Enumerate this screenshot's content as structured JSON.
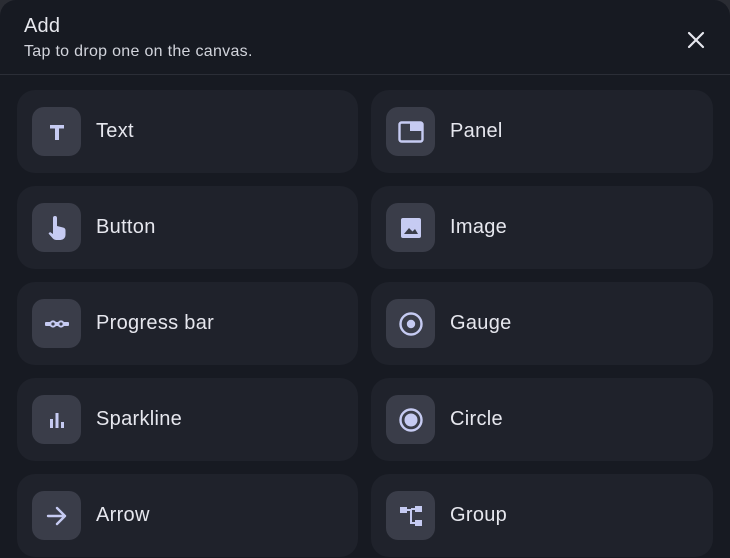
{
  "header": {
    "title": "Add",
    "subtitle": "Tap to drop one on the canvas."
  },
  "close_icon": "close-icon",
  "items": [
    {
      "label": "Text",
      "icon": "text-icon"
    },
    {
      "label": "Panel",
      "icon": "panel-icon"
    },
    {
      "label": "Button",
      "icon": "touch-icon"
    },
    {
      "label": "Image",
      "icon": "image-icon"
    },
    {
      "label": "Progress bar",
      "icon": "progress-icon"
    },
    {
      "label": "Gauge",
      "icon": "gauge-icon"
    },
    {
      "label": "Sparkline",
      "icon": "sparkline-icon"
    },
    {
      "label": "Circle",
      "icon": "circle-icon"
    },
    {
      "label": "Arrow",
      "icon": "arrow-icon"
    },
    {
      "label": "Group",
      "icon": "group-icon"
    }
  ],
  "colors": {
    "background": "#171a22",
    "tile": "#1f222b",
    "icon_bg": "#3a3d49",
    "icon_fg": "#c6cbf2",
    "text": "#e6e7ee"
  }
}
